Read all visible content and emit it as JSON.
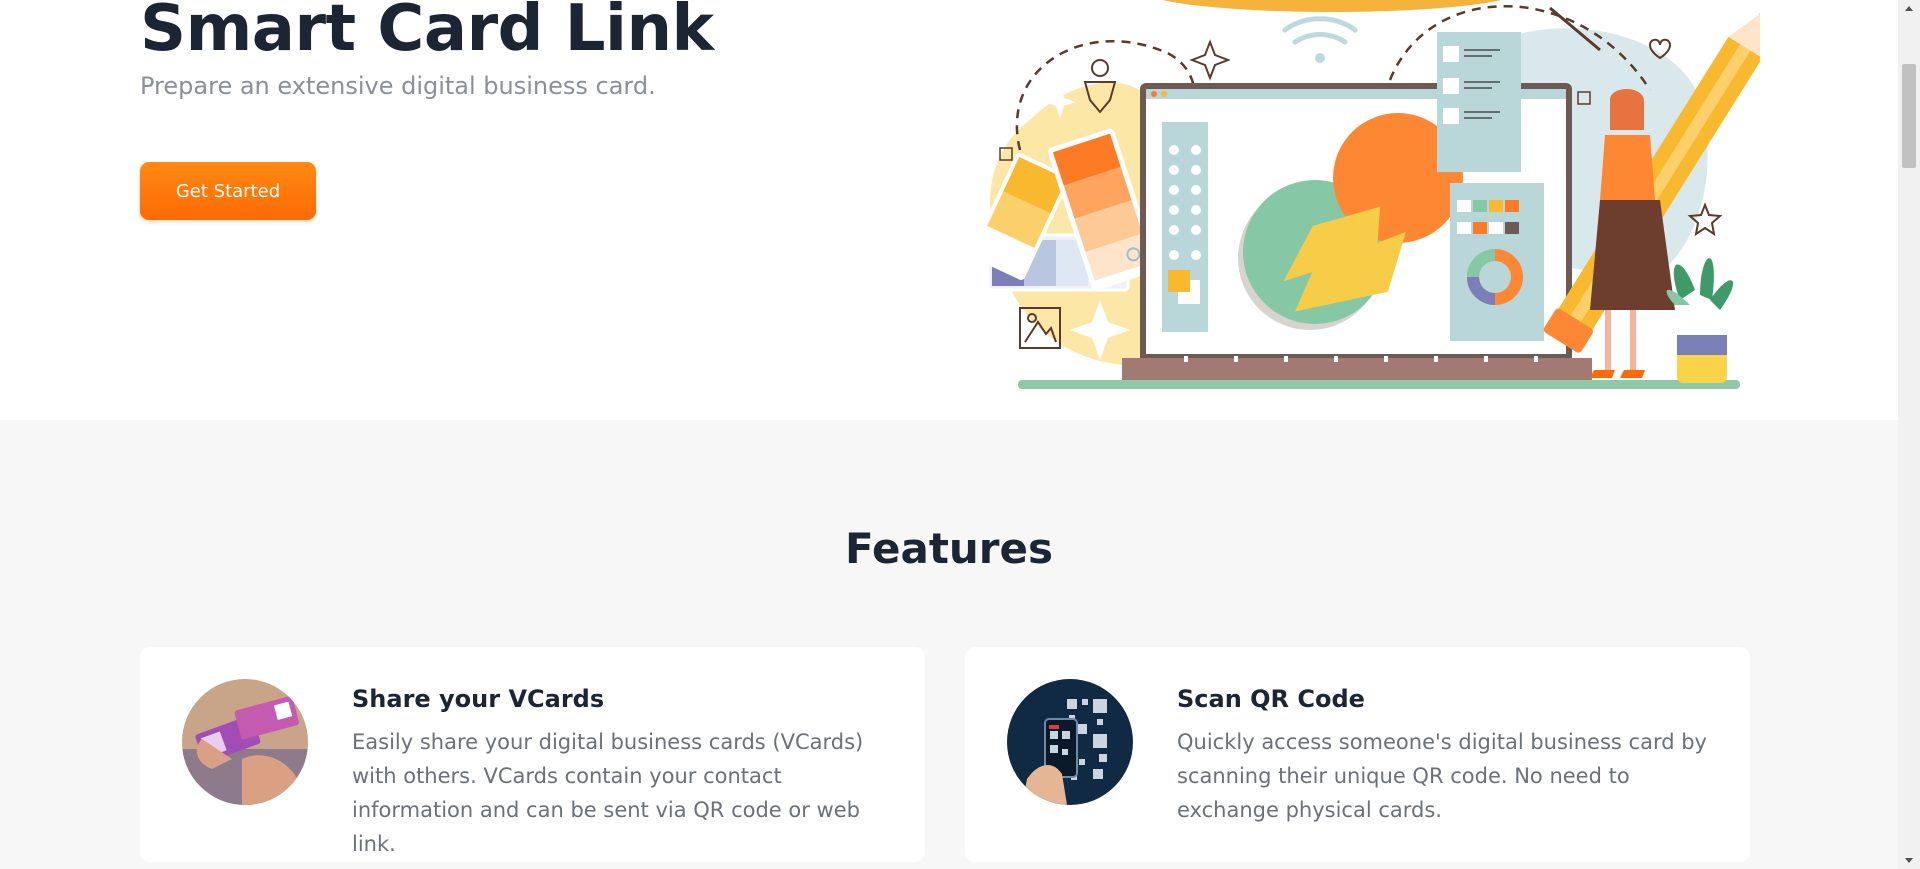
{
  "hero": {
    "title": "Smart Card Link",
    "subtitle": "Prepare an extensive digital business card.",
    "cta_label": "Get Started",
    "illustration": "designer-laptop-illustration"
  },
  "features": {
    "heading": "Features",
    "cards": [
      {
        "title": "Share your VCards",
        "description": "Easily share your digital business cards (VCards) with others. VCards contain your contact information and can be sent via QR code or web link.",
        "image": "share-vcards-photo"
      },
      {
        "title": "Scan QR Code",
        "description": "Quickly access someone's digital business card by scanning their unique QR code. No need to exchange physical cards.",
        "image": "scan-qr-photo"
      }
    ]
  },
  "colors": {
    "accent": "#fe7a0b",
    "heading": "#1b2533",
    "muted": "#8a8f99",
    "section_bg": "#f7f7f7"
  }
}
